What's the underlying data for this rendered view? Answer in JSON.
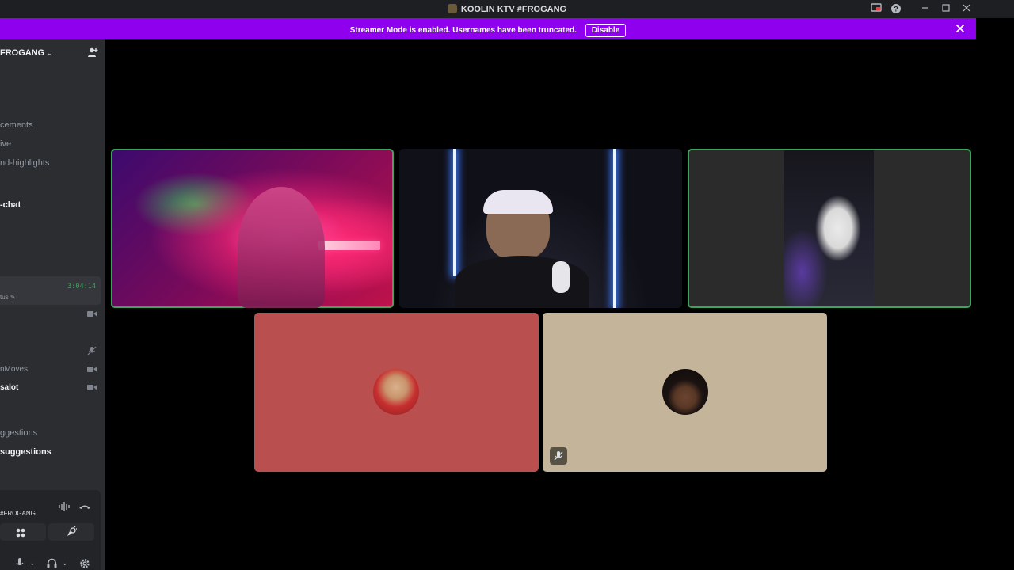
{
  "window": {
    "title": "KOOLIN KTV #FROGANG"
  },
  "banner": {
    "message": "Streamer Mode is enabled. Usernames have been truncated.",
    "disable_label": "Disable",
    "color": "#8f00ee"
  },
  "sidebar": {
    "server_name": "FROGANG",
    "channels": [
      {
        "label": "cements",
        "active": false
      },
      {
        "label": "ive",
        "active": false
      },
      {
        "label": "nd-highlights",
        "active": false
      },
      {
        "label": "-chat",
        "active": true
      }
    ],
    "voice": {
      "timer": "3:04:14",
      "status_label": "tus"
    },
    "users": [
      {
        "label": "nMoves",
        "bold": false,
        "icon": "camera-icon"
      },
      {
        "label": "salot",
        "bold": true,
        "icon": "camera-icon"
      }
    ],
    "suggestions": [
      {
        "label": "ggestions",
        "active": false
      },
      {
        "label": "suggestions",
        "active": true
      }
    ],
    "bottom_panel": {
      "connection_label": "#FROGANG"
    }
  },
  "tiles": [
    {
      "id": "streamer-1",
      "type": "video",
      "speaking": true
    },
    {
      "id": "streamer-2",
      "type": "video",
      "speaking": false
    },
    {
      "id": "streamer-3",
      "type": "video",
      "speaking": true
    },
    {
      "id": "participant-4",
      "type": "avatar",
      "bg_color": "#b94f4e",
      "muted": false
    },
    {
      "id": "participant-5",
      "type": "avatar",
      "bg_color": "#c4b59a",
      "muted": true
    }
  ],
  "colors": {
    "speaking_outline": "#3ba55c",
    "timer": "#3ba55c",
    "sidebar_bg": "#2b2d31",
    "titlebar_bg": "#1e1f22"
  }
}
